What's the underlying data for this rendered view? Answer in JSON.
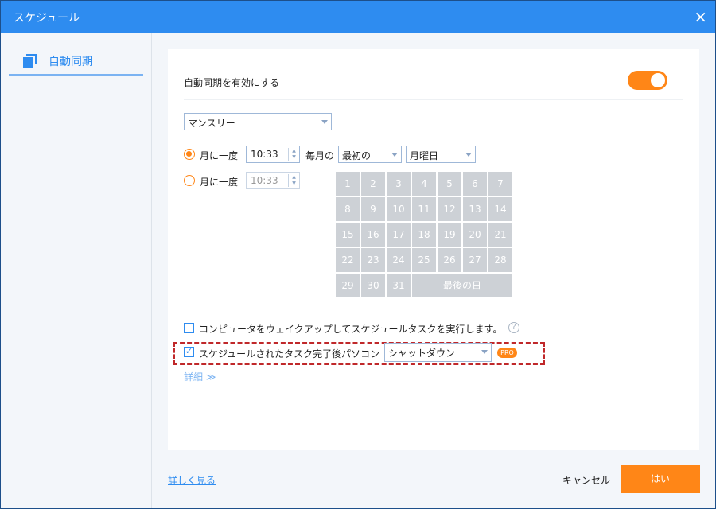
{
  "window": {
    "title": "スケジュール",
    "close_icon": "×"
  },
  "sidebar": {
    "items": [
      {
        "label": "自動同期",
        "icon": "copy-icon"
      }
    ]
  },
  "main": {
    "enable_label": "自動同期を有効にする",
    "enable_on": true,
    "frequency": "マンスリー",
    "option1": {
      "label": "月に一度",
      "time": "10:33",
      "each_month": "毎月の",
      "week_order": "最初の",
      "weekday": "月曜日",
      "selected": true
    },
    "option2": {
      "label": "月に一度",
      "time": "10:33",
      "selected": false
    },
    "calendar": {
      "days": [
        "1",
        "2",
        "3",
        "4",
        "5",
        "6",
        "7",
        "8",
        "9",
        "10",
        "11",
        "12",
        "13",
        "14",
        "15",
        "16",
        "17",
        "18",
        "19",
        "20",
        "21",
        "22",
        "23",
        "24",
        "25",
        "26",
        "27",
        "28",
        "29",
        "30",
        "31"
      ],
      "last_day": "最後の日"
    },
    "wake_label": "コンピュータをウェイクアップしてスケジュールタスクを実行します。",
    "wake_checked": false,
    "shutdown_label": "スケジュールされたタスク完了後パソコン",
    "shutdown_checked": true,
    "shutdown_action": "シャットダウン",
    "pro_badge": "PRO",
    "details": "詳細 ≫"
  },
  "footer": {
    "learn_more": "詳しく見る",
    "cancel": "キャンセル",
    "ok": "はい"
  },
  "colors": {
    "accent": "#2e8cf0",
    "orange": "#ff8617",
    "highlight": "#c0282a"
  }
}
